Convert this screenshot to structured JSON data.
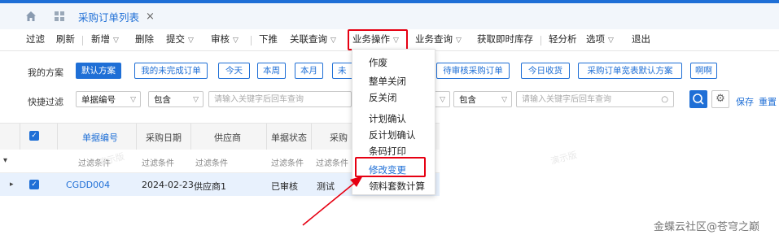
{
  "tab": {
    "title": "采购订单列表",
    "close": "×"
  },
  "toolbar": {
    "filter": "过滤",
    "refresh": "刷新",
    "new": "新增",
    "delete": "删除",
    "submit": "提交",
    "audit": "审核",
    "push_down": "下推",
    "related_query": "关联查询",
    "business_ops": "业务操作",
    "business_query": "业务查询",
    "get_inventory": "获取即时库存",
    "light_analysis": "轻分析",
    "options": "选项",
    "exit": "退出"
  },
  "schemes": {
    "label": "我的方案",
    "items": [
      "默认方案",
      "我的未完成订单",
      "今天",
      "本周",
      "本月",
      "未",
      "待审核采购订单",
      "今日收货",
      "采购订单宽表默认方案",
      "啊啊"
    ]
  },
  "quick_filter": {
    "label": "快捷过滤",
    "field1": "单据编号",
    "op1": "包含",
    "placeholder1": "请输入关键字后回车查询",
    "op2": "包含",
    "placeholder2": "请输入关键字后回车查询",
    "save": "保存",
    "reset": "重置"
  },
  "table": {
    "headers": [
      "单据编号",
      "采购日期",
      "供应商",
      "单据状态",
      "采购"
    ],
    "filter_placeholder": "过滤条件",
    "rows": [
      {
        "number": "CGDD004",
        "date": "2024-02-23",
        "supplier": "供应商1",
        "status": "已审核",
        "extra": "测试"
      }
    ]
  },
  "menu": {
    "items": [
      "作废",
      "整单关闭",
      "反关闭",
      "计划确认",
      "反计划确认",
      "条码打印",
      "修改变更",
      "领料套数计算"
    ],
    "highlighted": "修改变更"
  },
  "watermark": "演示版",
  "footer": "金蝶云社区@苍穹之巅",
  "colors": {
    "accent": "#1f6fd6",
    "highlight": "#e60012"
  }
}
